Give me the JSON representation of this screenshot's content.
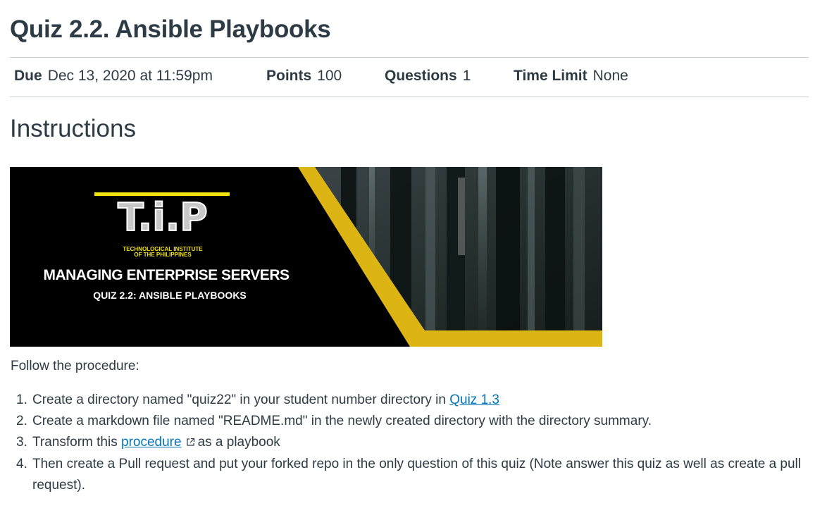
{
  "quiz": {
    "title": "Quiz 2.2. Ansible Playbooks"
  },
  "details": {
    "due_label": "Due",
    "due_value": "Dec 13, 2020 at 11:59pm",
    "points_label": "Points",
    "points_value": "100",
    "questions_label": "Questions",
    "questions_value": "1",
    "time_limit_label": "Time Limit",
    "time_limit_value": "None"
  },
  "instructions": {
    "heading": "Instructions",
    "banner": {
      "logo_text": "T.i.P",
      "institute_line1": "TECHNOLOGICAL INSTITUTE",
      "institute_line2": "OF THE PHILIPPINES",
      "course": "MANAGING ENTERPRISE SERVERS",
      "quiz": "QUIZ 2.2: ANSIBLE PLAYBOOKS"
    },
    "intro": "Follow the procedure:",
    "steps": [
      {
        "number": "1.",
        "text_before": "Create a directory named \"quiz22\" in your student number directory in ",
        "link": "Quiz 1.3"
      },
      {
        "number": "2.",
        "text": "Create a markdown file named \"README.md\" in the newly created directory with the directory summary."
      },
      {
        "number": "3.",
        "text_before": "Transform this ",
        "link": "procedure",
        "link_icon": "external-link-icon",
        "text_after": "as a playbook"
      },
      {
        "number": "4.",
        "text": "Then create a Pull request and put your forked repo in the only question of this quiz (Note answer this quiz as well as create a pull request)."
      }
    ]
  },
  "colors": {
    "text": "#2d3b45",
    "link": "#0374b5",
    "divider": "#c7cdd1",
    "banner_accent": "#dcb515"
  }
}
